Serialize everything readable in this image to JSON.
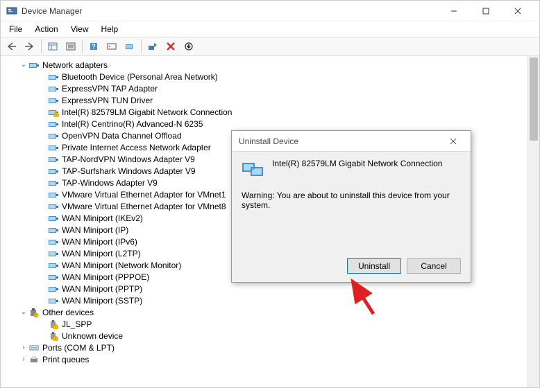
{
  "window": {
    "title": "Device Manager"
  },
  "menu": {
    "file": "File",
    "action": "Action",
    "view": "View",
    "help": "Help"
  },
  "tree": {
    "root_label": "Network adapters",
    "adapters": [
      "Bluetooth Device (Personal Area Network)",
      "ExpressVPN TAP Adapter",
      "ExpressVPN TUN Driver",
      "Intel(R) 82579LM Gigabit Network Connection",
      "Intel(R) Centrino(R) Advanced-N 6235",
      "OpenVPN Data Channel Offload",
      "Private Internet Access Network Adapter",
      "TAP-NordVPN Windows Adapter V9",
      "TAP-Surfshark Windows Adapter V9",
      "TAP-Windows Adapter V9",
      "VMware Virtual Ethernet Adapter for VMnet1",
      "VMware Virtual Ethernet Adapter for VMnet8",
      "WAN Miniport (IKEv2)",
      "WAN Miniport (IP)",
      "WAN Miniport (IPv6)",
      "WAN Miniport (L2TP)",
      "WAN Miniport (Network Monitor)",
      "WAN Miniport (PPPOE)",
      "WAN Miniport (PPTP)",
      "WAN Miniport (SSTP)"
    ],
    "other_label": "Other devices",
    "other_items": [
      "JL_SPP",
      "Unknown device"
    ],
    "ports_label": "Ports (COM & LPT)",
    "print_label": "Print queues"
  },
  "dialog": {
    "title": "Uninstall Device",
    "device": "Intel(R) 82579LM Gigabit Network Connection",
    "warning": "Warning: You are about to uninstall this device from your system.",
    "uninstall": "Uninstall",
    "cancel": "Cancel"
  }
}
